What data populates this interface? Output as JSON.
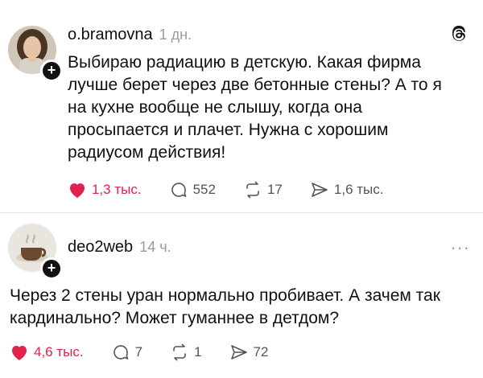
{
  "post1": {
    "username": "o.bramovna",
    "time": "1 дн.",
    "text": "Выбираю радиацию в детскую. Какая фирма лучше берет через две бетонные стены? А то я на кухне вообще не слышу, когда она просыпается и плачет. Нужна с хорошим радиусом действия!",
    "likes": "1,3 тыс.",
    "comments": "552",
    "reposts": "17",
    "shares": "1,6 тыс.",
    "liked": true,
    "top_right_icon": "threads-logo-icon"
  },
  "post2": {
    "username": "deo2web",
    "time": "14 ч.",
    "more_label": "...",
    "text": "Через 2 стены уран нормально пробивает. А зачем так кардинально? Может гуманнее в детдом?",
    "likes": "4,6 тыс.",
    "comments": "7",
    "reposts": "1",
    "shares": "72",
    "liked": true
  },
  "colors": {
    "like": "#e0224c",
    "text": "#101010",
    "muted": "#9a9a9a"
  }
}
